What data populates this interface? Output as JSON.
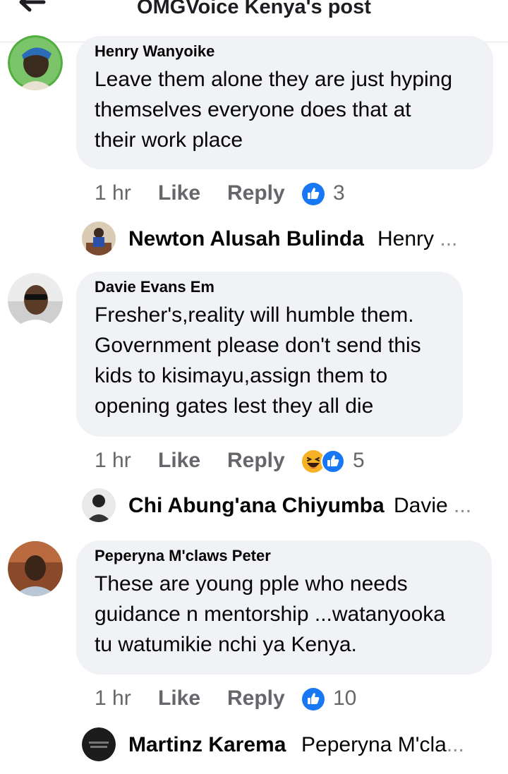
{
  "header": {
    "title": "OMGVoice Kenya's post",
    "back_icon": "arrow-left-icon"
  },
  "colors": {
    "bubble": "#f0f2f5",
    "like_blue": "#1877f2",
    "meta_grey": "#65676b",
    "haha_yellow": "#f7b125"
  },
  "comments": [
    {
      "author": "Henry Wanyoike",
      "lines": [
        "Leave them alone they are just hyping",
        "themselves everyone does that at",
        "their work place"
      ],
      "time": "1 hr",
      "like_label": "Like",
      "reply_label": "Reply",
      "reactions": [
        "like-icon"
      ],
      "reaction_count": "3",
      "reply": {
        "name": "Newton Alusah Bulinda",
        "snippet": "Henry",
        "ellipsis": "..."
      }
    },
    {
      "author": "Davie Evans Em",
      "lines": [
        "Fresher's,reality will humble them.",
        "Government please don't send this",
        "kids to kisimayu,assign them to",
        "opening gates lest they all die"
      ],
      "time": "1 hr",
      "like_label": "Like",
      "reply_label": "Reply",
      "reactions": [
        "haha-icon",
        "like-icon"
      ],
      "reaction_count": "5",
      "reply": {
        "name": "Chi Abung'ana Chiyumba",
        "snippet": "Davie",
        "ellipsis": "..."
      }
    },
    {
      "author": "Peperyna M'claws Peter",
      "lines": [
        "These are young pple who needs",
        "guidance n mentorship ...watanyooka",
        "tu watumikie nchi ya Kenya."
      ],
      "time": "1 hr",
      "like_label": "Like",
      "reply_label": "Reply",
      "reactions": [
        "like-icon"
      ],
      "reaction_count": "10",
      "reply": {
        "name": "Martinz Karema",
        "snippet": "Peperyna M'cla",
        "ellipsis": "..."
      }
    }
  ]
}
